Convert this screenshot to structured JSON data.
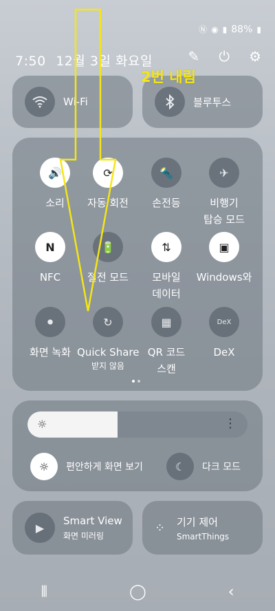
{
  "status": {
    "battery": "88%"
  },
  "header": {
    "time": "7:50",
    "date": "12월 3일 화요일"
  },
  "annotation": {
    "text": "2번 내림",
    "color": "#f5e614"
  },
  "top_tiles": [
    {
      "label": "Wi-Fi",
      "icon": "wifi-icon"
    },
    {
      "label": "블루투스",
      "icon": "bluetooth-icon"
    }
  ],
  "quick_tiles": [
    {
      "label": "소리",
      "sub": "",
      "on": true
    },
    {
      "label": "자동 회전",
      "sub": "",
      "on": true
    },
    {
      "label": "손전등",
      "sub": "",
      "on": false
    },
    {
      "label": "비행기",
      "sub": "탑승 모드",
      "on": false
    },
    {
      "label": "NFC",
      "sub": "",
      "on": true
    },
    {
      "label": "절전 모드",
      "sub": "",
      "on": false
    },
    {
      "label": "모바일",
      "sub": "데이터",
      "on": true
    },
    {
      "label": "Windows와",
      "sub": "",
      "on": true
    },
    {
      "label": "화면 녹화",
      "sub": "",
      "on": false
    },
    {
      "label": "Quick Share",
      "sub": "받지 않음",
      "on": false
    },
    {
      "label": "QR 코드",
      "sub": "스캔",
      "on": false
    },
    {
      "label": "DeX",
      "sub": "",
      "on": false
    }
  ],
  "brightness": {
    "level": 0.41
  },
  "toggles": [
    {
      "label": "편안하게 화면 보기"
    },
    {
      "label": "다크 모드"
    }
  ],
  "bottom_tiles": [
    {
      "title": "Smart View",
      "sub": "화면 미러링"
    },
    {
      "title": "기기 제어",
      "sub": "SmartThings"
    }
  ]
}
